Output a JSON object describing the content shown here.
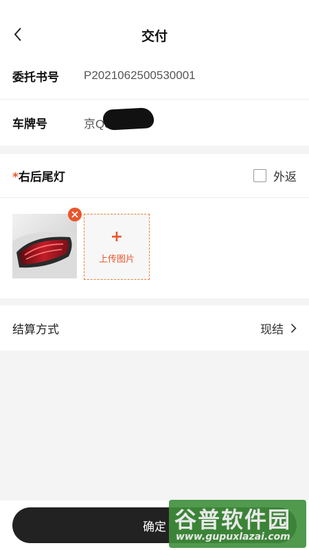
{
  "header": {
    "title": "交付",
    "back_icon": "chevron-left-icon"
  },
  "info": {
    "entrust_label": "委托书号",
    "entrust_value": "P2021062500530001",
    "plate_label": "车牌号",
    "plate_value": "京Q5"
  },
  "part": {
    "required_mark": "*",
    "name": "右后尾灯",
    "return_label": "外返",
    "return_checked": false,
    "upload_plus": "+",
    "upload_label": "上传图片",
    "remove_icon": "close-icon"
  },
  "settlement": {
    "label": "结算方式",
    "value": "现结",
    "arrow_icon": "chevron-right-icon"
  },
  "footer": {
    "confirm_label": "确定"
  },
  "watermark": {
    "main": "谷普软件园",
    "sub": "www.gupuxlazai.com"
  },
  "colors": {
    "accent": "#e8562a",
    "button": "#222222",
    "status_dot": "#2ecc5a",
    "watermark": "#3e8f3a"
  }
}
